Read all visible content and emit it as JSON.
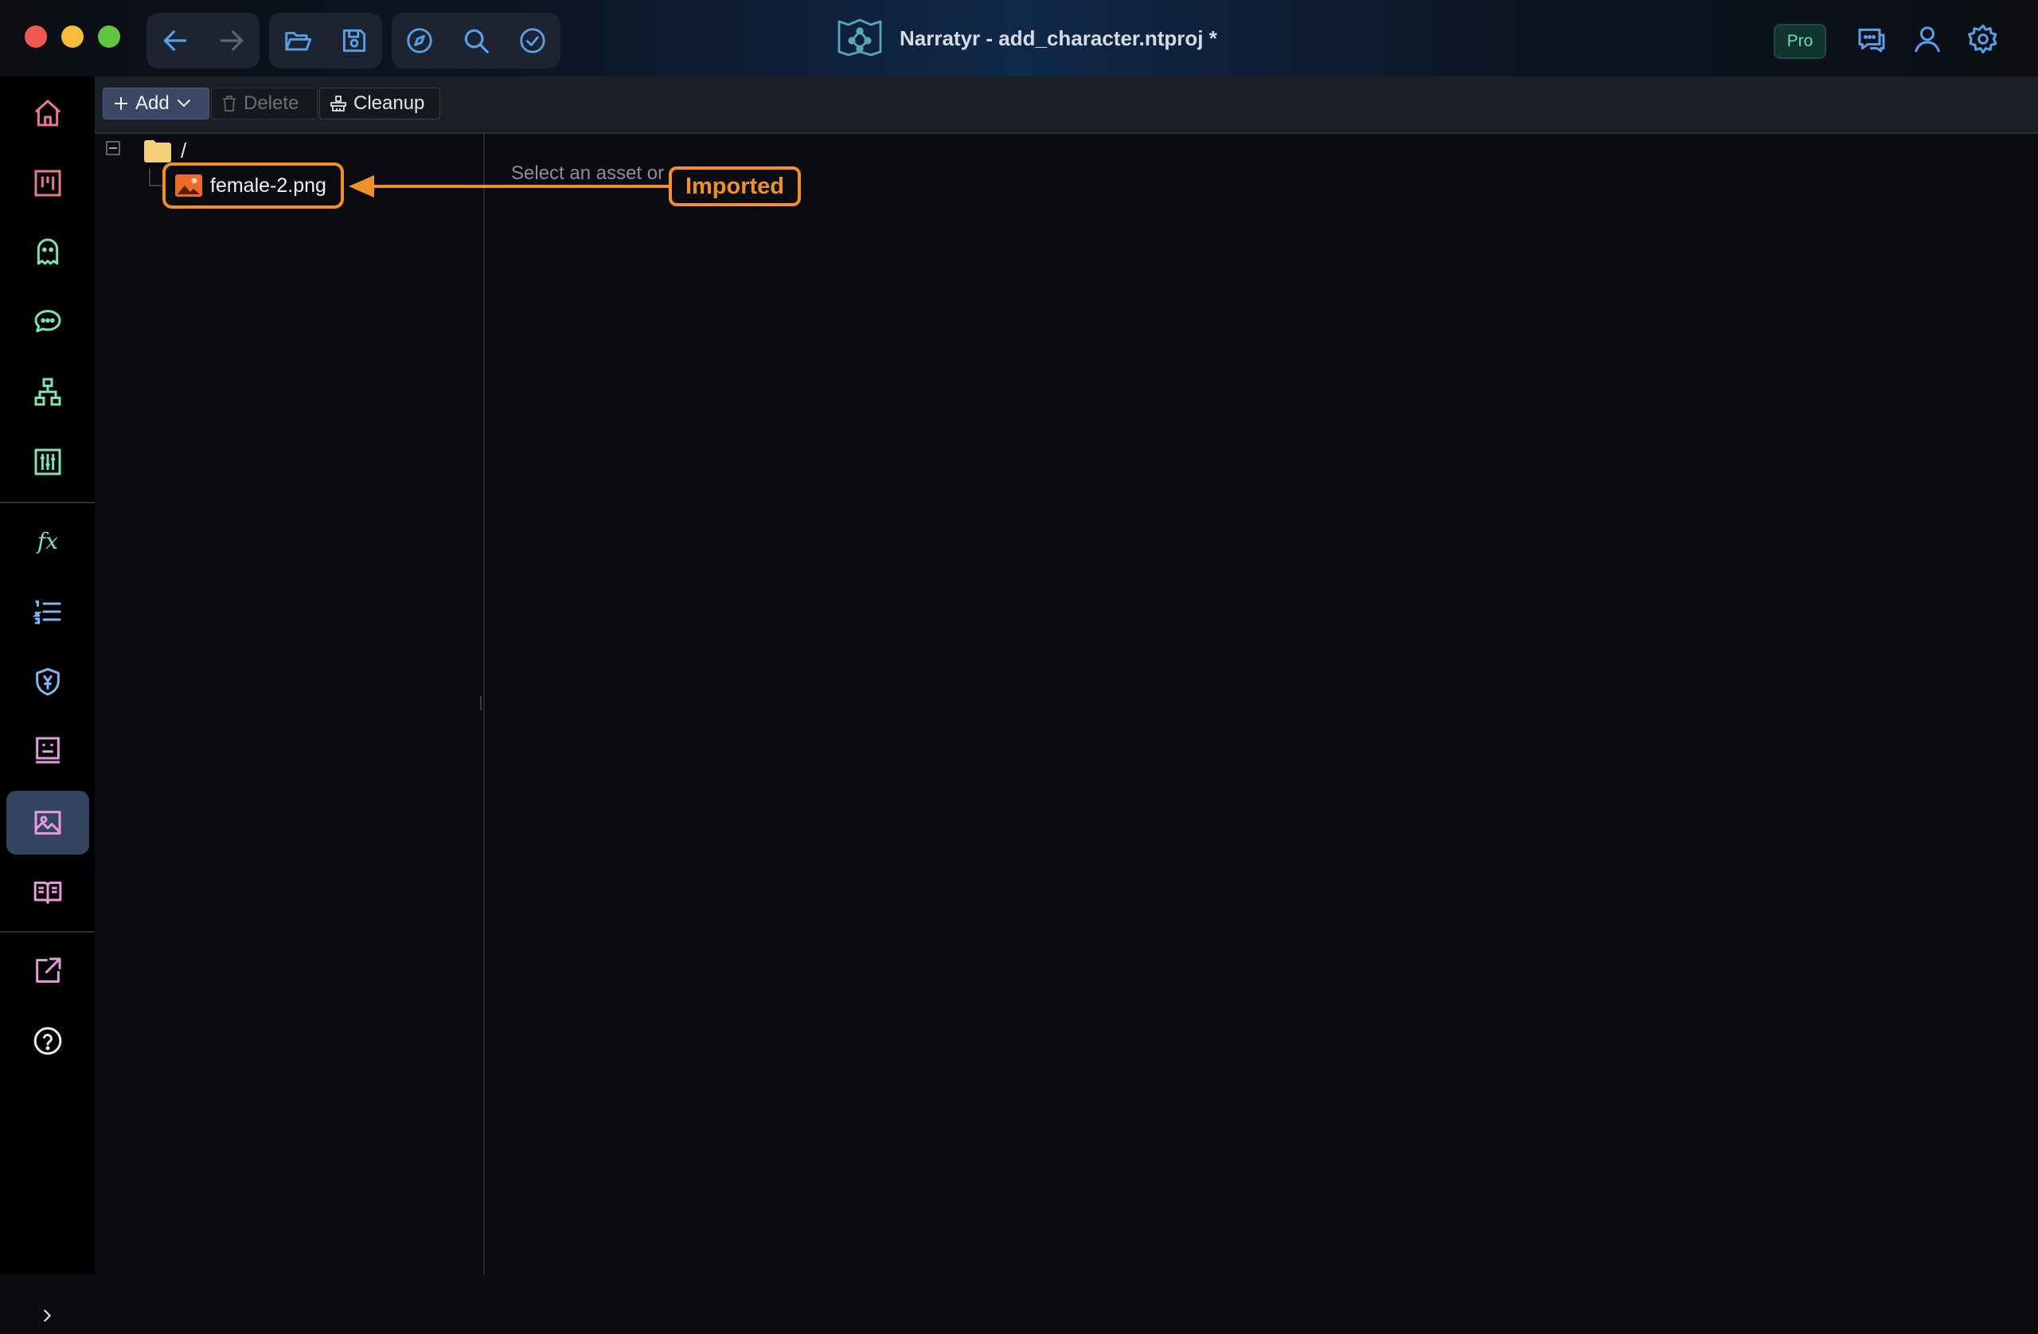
{
  "window": {
    "title": "Narratyr - add_character.ntproj *",
    "plan_badge": "Pro"
  },
  "titlebar_buttons": {
    "history": [
      "back-icon",
      "forward-icon"
    ],
    "file": [
      "open-folder-icon",
      "save-icon"
    ],
    "tools": [
      "compass-icon",
      "search-icon",
      "check-circle-icon"
    ],
    "right": [
      "chat-icon",
      "user-icon",
      "gear-icon"
    ]
  },
  "sidebar": {
    "items": [
      {
        "icon": "home-icon"
      },
      {
        "icon": "kanban-board-icon"
      },
      {
        "icon": "ghost-icon"
      },
      {
        "icon": "dialogue-icon"
      },
      {
        "icon": "hierarchy-icon"
      },
      {
        "icon": "sliders-icon"
      },
      {
        "icon": "function-icon",
        "label": "fx"
      },
      {
        "icon": "numbered-list-icon"
      },
      {
        "icon": "currency-shield-icon",
        "label": "¥"
      },
      {
        "icon": "notes-icon"
      },
      {
        "icon": "image-icon",
        "active": true
      },
      {
        "icon": "book-icon"
      },
      {
        "icon": "export-icon"
      },
      {
        "icon": "help-icon",
        "label": "?"
      }
    ]
  },
  "toolbar": {
    "add_label": "Add",
    "delete_label": "Delete",
    "cleanup_label": "Cleanup"
  },
  "tree": {
    "root_label": "/",
    "items": [
      {
        "name": "female-2.png",
        "type": "image"
      }
    ]
  },
  "detail": {
    "hint": "Select an asset or"
  },
  "annotation": {
    "label": "Imported",
    "color": "#f0902a"
  },
  "colors": {
    "accent_blue": "#5aa0e8",
    "icon_green": "#7fe3b0",
    "icon_pink": "#e69adf",
    "active_nav_bg": "#354460"
  }
}
